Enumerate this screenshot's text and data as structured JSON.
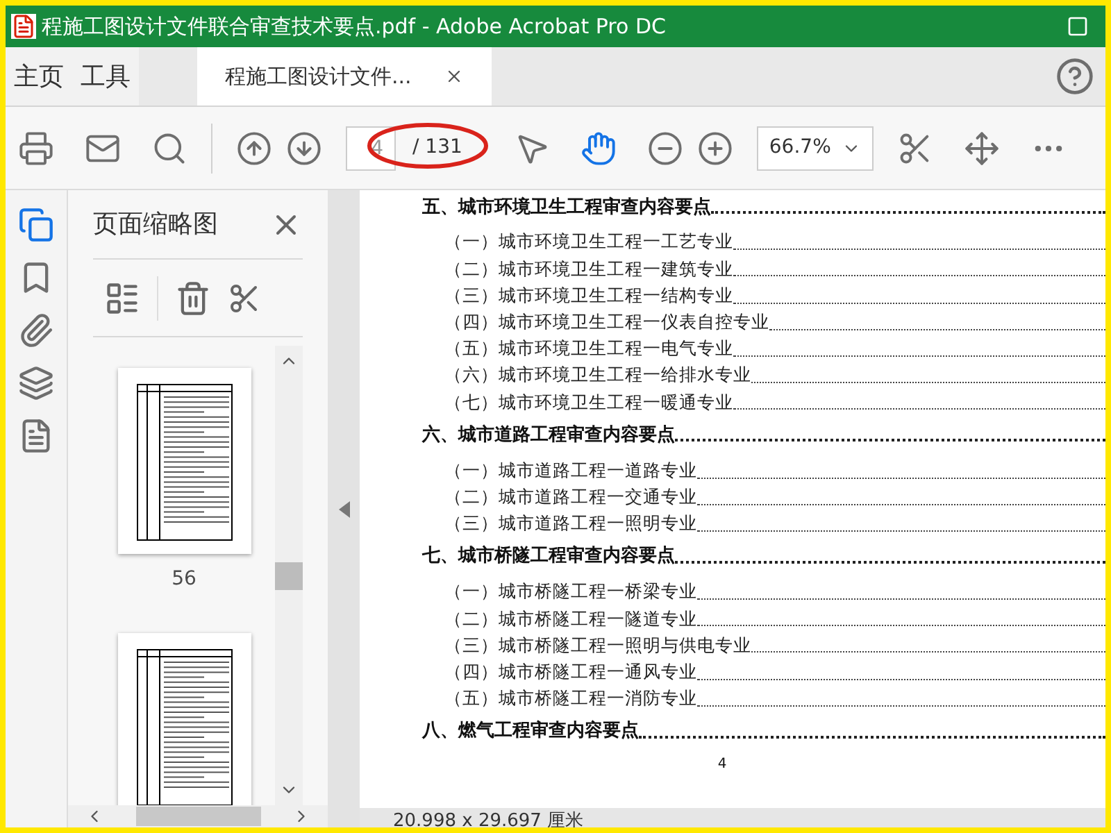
{
  "window": {
    "title": "程施工图设计文件联合审查技术要点.pdf - Adobe Acrobat Pro DC"
  },
  "tabs": [
    {
      "label": "主页",
      "selected": false
    },
    {
      "label": "工具",
      "selected": false
    },
    {
      "label": "程施工图设计文件...",
      "selected": true
    }
  ],
  "toolbar": {
    "page_field": {
      "value": "4"
    },
    "page_total": "/ 131",
    "zoom": "66.7%",
    "hand_tool": {
      "selected": true
    }
  },
  "sidebar_panel": {
    "title": "页面缩略图",
    "thumbnails": [
      {
        "kind": "page",
        "label": "56"
      },
      {
        "kind": "page"
      }
    ]
  },
  "document": {
    "sections": [
      {
        "heading": "五、城市环境卫生工程审查内容要点",
        "items": [
          "（一）城市环境卫生工程一工艺专业",
          "（二）城市环境卫生工程一建筑专业",
          "（三）城市环境卫生工程一结构专业",
          "（四）城市环境卫生工程一仪表自控专业",
          "（五）城市环境卫生工程一电气专业",
          "（六）城市环境卫生工程一给排水专业",
          "（七）城市环境卫生工程一暖通专业"
        ]
      },
      {
        "heading": "六、城市道路工程审查内容要点",
        "items": [
          "（一）城市道路工程一道路专业",
          "（二）城市道路工程一交通专业",
          "（三）城市道路工程一照明专业"
        ]
      },
      {
        "heading": "七、城市桥隧工程审查内容要点",
        "items": [
          "（一）城市桥隧工程一桥梁专业",
          "（二）城市桥隧工程一隧道专业",
          "（三）城市桥隧工程一照明与供电专业",
          "（四）城市桥隧工程一通风专业",
          "（五）城市桥隧工程一消防专业"
        ]
      },
      {
        "heading": "八、燃气工程审查内容要点"
      }
    ],
    "page_number": "4"
  },
  "status_bar": {
    "page_size": "20.998 x 29.697 厘米"
  }
}
